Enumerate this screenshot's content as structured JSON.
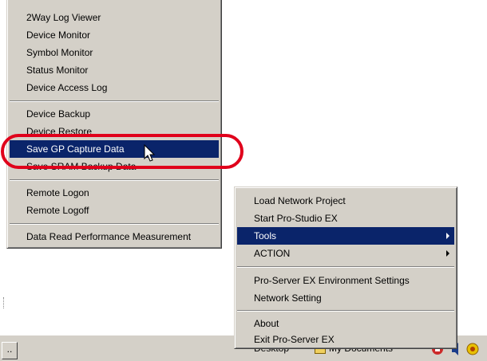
{
  "left_menu": {
    "items_group1": [
      "2Way Log Viewer",
      "Device Monitor",
      "Symbol Monitor",
      "Status Monitor",
      "Device Access Log"
    ],
    "items_group2": [
      "Device Backup",
      "Device Restore",
      "Save GP Capture Data",
      "Save SRAM Backup Data"
    ],
    "items_group3": [
      "Remote Logon",
      "Remote Logoff"
    ],
    "items_group4": [
      "Data Read Performance Measurement"
    ],
    "selected": "Save GP Capture Data"
  },
  "right_menu": {
    "items_group1": [
      "Load Network Project",
      "Start Pro-Studio EX",
      "Tools",
      "ACTION"
    ],
    "items_group2": [
      "Pro-Server EX Environment Settings",
      "Network Setting"
    ],
    "items_group3": [
      "About",
      "Exit Pro-Server EX"
    ],
    "selected": "Tools",
    "submenu_items": [
      "Tools",
      "ACTION"
    ]
  },
  "taskbar": {
    "button_label": "..",
    "desktop_text": "Desktop",
    "documents_text": "My Documents"
  },
  "colors": {
    "menu_bg": "#d4d0c8",
    "selection_bg": "#0a246a",
    "highlight_ring": "#e0001b"
  }
}
